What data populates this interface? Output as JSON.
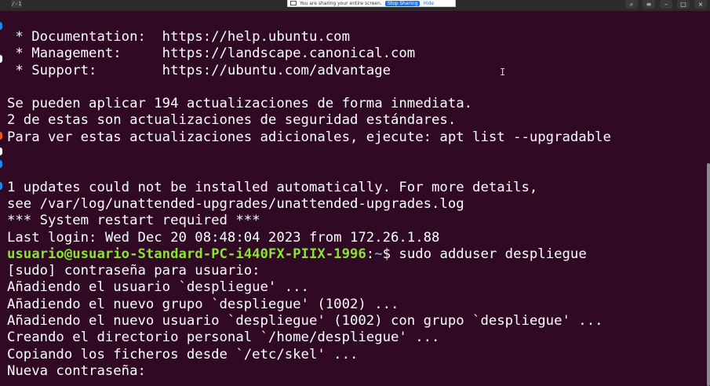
{
  "titlebar": {
    "tab_label": "/-1",
    "share_banner": {
      "text": "You are sharing your entire screen.",
      "stop_label": "Stop Sharing",
      "hide_label": "Hide"
    },
    "window_buttons": [
      "search-icon",
      "menu-icon",
      "minimize-icon",
      "maximize-icon",
      "close-icon"
    ],
    "window_button_glyphs": [
      "⌕",
      "≡",
      "–",
      "□",
      "×"
    ]
  },
  "dock_colors": [
    "#1e88e5",
    "#ffffff",
    "#e95420",
    "#ffffff",
    "#1e88e5",
    "#1e88e5"
  ],
  "terminal": {
    "lines": [
      " * Documentation:  https://help.ubuntu.com",
      " * Management:     https://landscape.canonical.com",
      " * Support:        https://ubuntu.com/advantage",
      "",
      "Se pueden aplicar 194 actualizaciones de forma inmediata.",
      "2 de estas son actualizaciones de seguridad estándares.",
      "Para ver estas actualizaciones adicionales, ejecute: apt list --upgradable",
      "",
      "",
      "1 updates could not be installed automatically. For more details,",
      "see /var/log/unattended-upgrades/unattended-upgrades.log",
      "*** System restart required ***",
      "Last login: Wed Dec 20 08:48:04 2023 from 172.26.1.88"
    ],
    "prompt": {
      "user_host": "usuario@usuario-Standard-PC-i440FX-PIIX-1996",
      "sep": ":",
      "path": "~",
      "symbol": "$ ",
      "command": "sudo adduser despliegue"
    },
    "output": [
      "[sudo] contraseña para usuario:",
      "Añadiendo el usuario `despliegue' ...",
      "Añadiendo el nuevo grupo `despliegue' (1002) ...",
      "Añadiendo el nuevo usuario `despliegue' (1002) con grupo `despliegue' ...",
      "Creando el directorio personal `/home/despliegue' ...",
      "Copiando los ficheros desde `/etc/skel' ...",
      "Nueva contraseña:"
    ]
  },
  "colors": {
    "background": "#300a24",
    "text": "#ffffff",
    "prompt_user": "#8ae234",
    "prompt_path": "#729fcf"
  }
}
